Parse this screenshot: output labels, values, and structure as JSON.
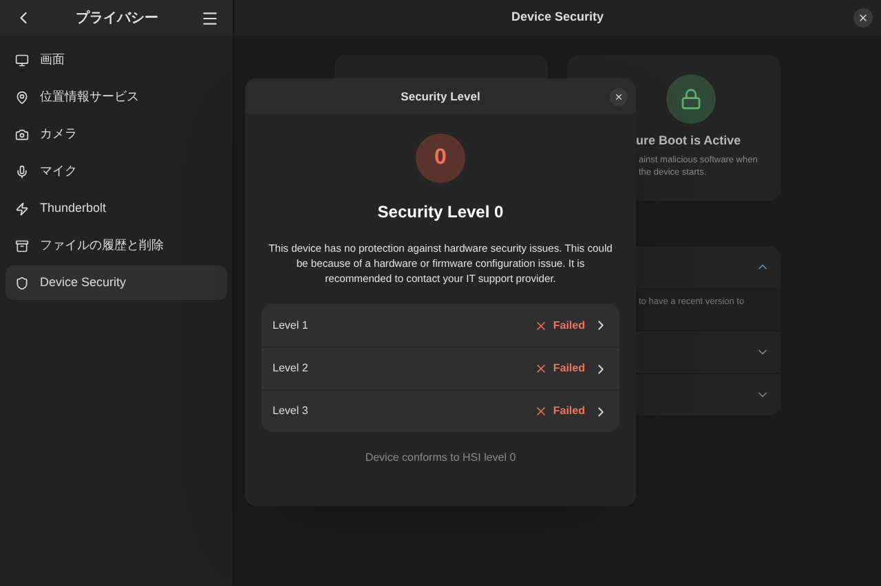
{
  "sidebar": {
    "title": "プライバシー",
    "items": [
      {
        "label": "画面",
        "selected": false
      },
      {
        "label": "位置情報サービス",
        "selected": false
      },
      {
        "label": "カメラ",
        "selected": false
      },
      {
        "label": "マイク",
        "selected": false
      },
      {
        "label": "Thunderbolt",
        "selected": false
      },
      {
        "label": "ファイルの履歴と削除",
        "selected": false
      },
      {
        "label": "Device Security",
        "selected": true
      }
    ]
  },
  "header": {
    "title": "Device Security"
  },
  "background": {
    "secure_boot": {
      "title": "ure Boot is Active",
      "description": "ainst malicious software when\nthe device starts."
    },
    "rows": [
      {
        "expanded": true,
        "description": "to have a recent version to"
      },
      {
        "expanded": false
      },
      {
        "expanded": false
      }
    ]
  },
  "dialog": {
    "title": "Security Level",
    "level": "0",
    "heading": "Security Level 0",
    "text": "This device has no protection against hardware security issues. This could be because of a hardware or firmware configuration issue. It is recommended to contact your IT support provider.",
    "levels": [
      {
        "label": "Level 1",
        "status": "Failed",
        "passed": false
      },
      {
        "label": "Level 2",
        "status": "Failed",
        "passed": false
      },
      {
        "label": "Level 3",
        "status": "Failed",
        "passed": false
      }
    ],
    "footer": "Device conforms to HSI level 0"
  }
}
